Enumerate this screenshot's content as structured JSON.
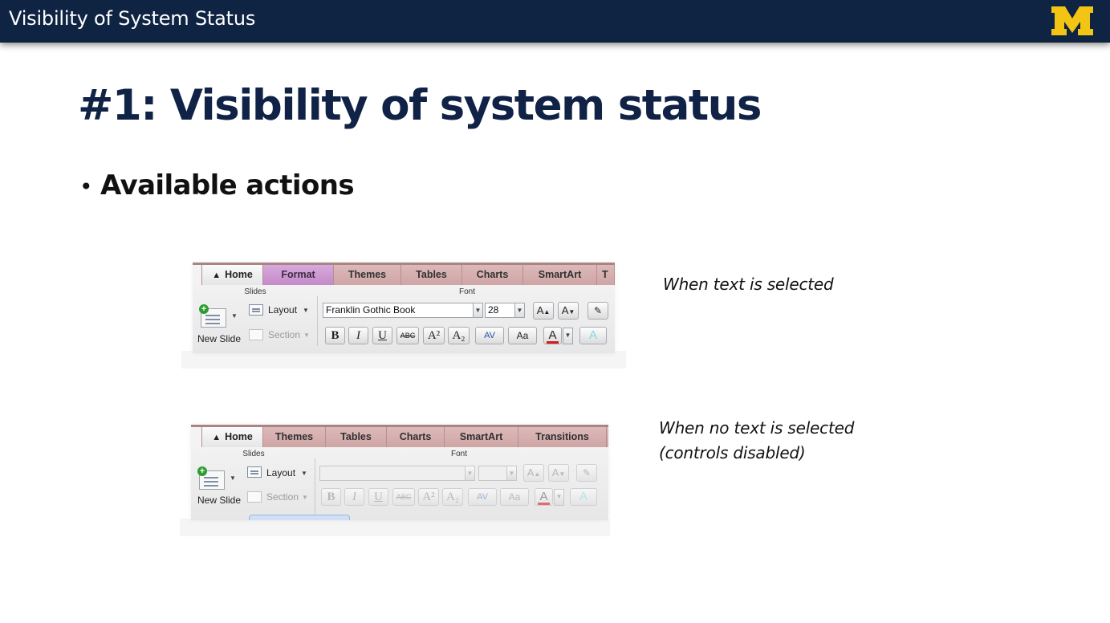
{
  "header": {
    "title": "Visibility of System Status",
    "logo_icon": "block-m-logo",
    "logo_color": "#f2c413"
  },
  "slide": {
    "title": "#1: Visibility of system status",
    "bullet": "Available actions"
  },
  "captions": {
    "selected": "When text is selected",
    "not_selected_line1": "When no text is selected",
    "not_selected_line2": "(controls disabled)"
  },
  "ribbon_selected": {
    "tabs": [
      "Home",
      "Format",
      "Themes",
      "Tables",
      "Charts",
      "SmartArt",
      "T"
    ],
    "groups": {
      "slides": "Slides",
      "font": "Font"
    },
    "new_slide": "New Slide",
    "layout": "Layout",
    "section": "Section",
    "font_name": "Franklin Gothic Book",
    "font_size": "28",
    "format_buttons": [
      "B",
      "I",
      "U",
      "ABC",
      "A²",
      "A₂",
      "AV",
      "Aa",
      "A",
      "A"
    ]
  },
  "ribbon_unselected": {
    "tabs": [
      "Home",
      "Themes",
      "Tables",
      "Charts",
      "SmartArt",
      "Transitions"
    ],
    "groups": {
      "slides": "Slides",
      "font": "Font"
    },
    "new_slide": "New Slide",
    "layout": "Layout",
    "section": "Section",
    "format_buttons": [
      "B",
      "I",
      "U",
      "ABC",
      "A²",
      "A₂",
      "AV",
      "Aa",
      "A",
      "A"
    ]
  },
  "colors": {
    "header_bg": "#0f2342",
    "title_color": "#102246",
    "tab_bar": "#cfa5a5",
    "format_tab": "#c48ac9",
    "font_color_bar": "#d21e1e"
  }
}
